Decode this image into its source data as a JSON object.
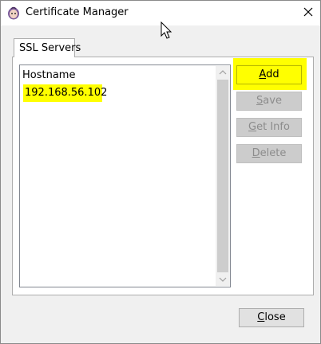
{
  "window": {
    "title": "Certificate Manager"
  },
  "tabs": [
    {
      "label": "SSL Servers"
    }
  ],
  "list": {
    "header": "Hostname",
    "items": [
      {
        "hostname": "192.168.56.102"
      }
    ]
  },
  "buttons": {
    "add": {
      "label": "Add",
      "mnemonic": "A",
      "rest": "dd"
    },
    "save": {
      "label": "Save",
      "mnemonic": "S",
      "rest": "ave"
    },
    "get_info": {
      "label": "Get Info",
      "mnemonic": "G",
      "rest": "et Info"
    },
    "delete": {
      "label": "Delete",
      "mnemonic": "D",
      "rest": "elete"
    },
    "close": {
      "label": "Close",
      "mnemonic": "C",
      "rest": "lose"
    }
  },
  "colors": {
    "highlight": "#ffff00",
    "window_bg": "#f0f0f0",
    "disabled_text": "#8c8c8c"
  },
  "icons": {
    "app": "certificate-manager-app-icon",
    "close": "close-icon",
    "cursor": "mouse-pointer-icon"
  }
}
